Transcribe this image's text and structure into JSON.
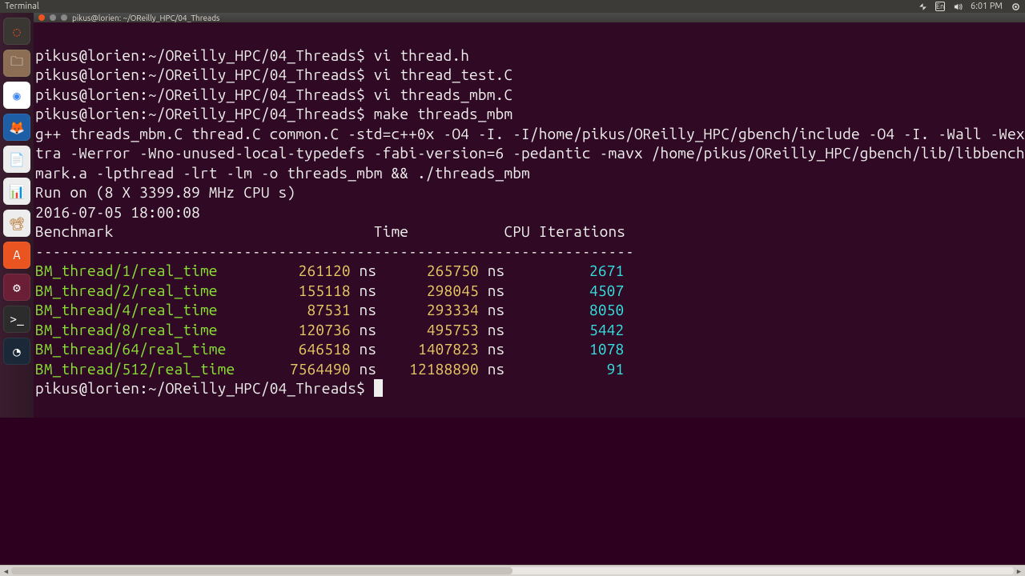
{
  "menubar": {
    "app_label": "Terminal",
    "clock": "6:01 PM",
    "lang_indicator": "En"
  },
  "window": {
    "title": "pikus@lorien: ~/OReilly_HPC/04_Threads"
  },
  "prompt": {
    "userhost": "pikus@lorien",
    "path": "~/OReilly_HPC/04_Threads",
    "sep": "$"
  },
  "history": {
    "cmd1": "vi thread.h",
    "cmd2": "vi thread_test.C",
    "cmd3": "vi threads_mbm.C",
    "cmd4": "make threads_mbm"
  },
  "make_output": "g++ threads_mbm.C thread.C common.C -std=c++0x -O4 -I. -I/home/pikus/OReilly_HPC/gbench/include -O4 -I. -Wall -Wextra -Werror -Wno-unused-local-typedefs -fabi-version=6 -pedantic -mavx /home/pikus/OReilly_HPC/gbench/lib/libbenchmark.a -lpthread -lrt -lm -o threads_mbm && ./threads_mbm",
  "run_info": {
    "line1": "Run on (8 X 3399.89 MHz CPU s)",
    "line2": "2016-07-05 18:00:08"
  },
  "bench_header": "Benchmark                              Time           CPU Iterations",
  "bench_sep": "---------------------------------------------------------------------",
  "bench_rows": [
    {
      "name": "BM_thread/1/real_time",
      "time": "261120",
      "unit": "ns",
      "cpu": "265750",
      "cpu_unit": "ns",
      "iters": "2671"
    },
    {
      "name": "BM_thread/2/real_time",
      "time": "155118",
      "unit": "ns",
      "cpu": "298045",
      "cpu_unit": "ns",
      "iters": "4507"
    },
    {
      "name": "BM_thread/4/real_time",
      "time": "87531",
      "unit": "ns",
      "cpu": "293334",
      "cpu_unit": "ns",
      "iters": "8050"
    },
    {
      "name": "BM_thread/8/real_time",
      "time": "120736",
      "unit": "ns",
      "cpu": "495753",
      "cpu_unit": "ns",
      "iters": "5442"
    },
    {
      "name": "BM_thread/64/real_time",
      "time": "646518",
      "unit": "ns",
      "cpu": "1407823",
      "cpu_unit": "ns",
      "iters": "1078"
    },
    {
      "name": "BM_thread/512/real_time",
      "time": "7564490",
      "unit": "ns",
      "cpu": "12188890",
      "cpu_unit": "ns",
      "iters": "91"
    }
  ],
  "launcher": {
    "items": [
      {
        "name": "dash",
        "bg": "#3a3632",
        "glyph": "◌",
        "glyph_color": "#e95420"
      },
      {
        "name": "files",
        "bg": "#8b6e54",
        "glyph": "🗀",
        "glyph_color": "#ffffff"
      },
      {
        "name": "chrome",
        "bg": "#ffffff",
        "glyph": "◉",
        "glyph_color": "#4285f4"
      },
      {
        "name": "firefox",
        "bg": "#1d5ea7",
        "glyph": "🦊",
        "glyph_color": "#ff7139"
      },
      {
        "name": "writer",
        "bg": "#ededed",
        "glyph": "📄",
        "glyph_color": "#1565c0"
      },
      {
        "name": "calc",
        "bg": "#ededed",
        "glyph": "📊",
        "glyph_color": "#2e7d32"
      },
      {
        "name": "impress",
        "bg": "#ededed",
        "glyph": "📽",
        "glyph_color": "#b36a1e"
      },
      {
        "name": "software",
        "bg": "#e95420",
        "glyph": "A",
        "glyph_color": "#ffffff"
      },
      {
        "name": "settings",
        "bg": "#6b1f36",
        "glyph": "⚙",
        "glyph_color": "#ffffff"
      },
      {
        "name": "terminal",
        "bg": "#2c2c2c",
        "glyph": ">_",
        "glyph_color": "#ffffff"
      },
      {
        "name": "steam",
        "bg": "#1b2838",
        "glyph": "◔",
        "glyph_color": "#ffffff"
      }
    ]
  }
}
